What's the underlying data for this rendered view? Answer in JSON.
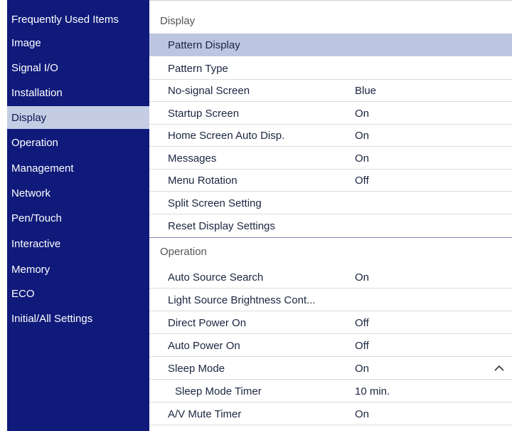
{
  "sidebar": {
    "items": [
      {
        "label": "Frequently Used Items"
      },
      {
        "label": "Image"
      },
      {
        "label": "Signal I/O"
      },
      {
        "label": "Installation"
      },
      {
        "label": "Display"
      },
      {
        "label": "Operation"
      },
      {
        "label": "Management"
      },
      {
        "label": "Network"
      },
      {
        "label": "Pen/Touch"
      },
      {
        "label": "Interactive"
      },
      {
        "label": "Memory"
      },
      {
        "label": "ECO"
      },
      {
        "label": "Initial/All Settings"
      }
    ],
    "active": "Display"
  },
  "main": {
    "display_section": {
      "title": "Display",
      "rows": [
        {
          "label": "Pattern Display",
          "value": ""
        },
        {
          "label": "Pattern Type",
          "value": ""
        },
        {
          "label": "No-signal Screen",
          "value": "Blue"
        },
        {
          "label": "Startup Screen",
          "value": "On"
        },
        {
          "label": "Home Screen Auto Disp.",
          "value": "On"
        },
        {
          "label": "Messages",
          "value": "On"
        },
        {
          "label": "Menu Rotation",
          "value": "Off"
        },
        {
          "label": "Split Screen Setting",
          "value": ""
        },
        {
          "label": "Reset Display Settings",
          "value": ""
        }
      ]
    },
    "operation_section": {
      "title": "Operation",
      "rows": [
        {
          "label": "Auto Source Search",
          "value": "On"
        },
        {
          "label": "Light Source Brightness Cont...",
          "value": ""
        },
        {
          "label": "Direct Power On",
          "value": "Off"
        },
        {
          "label": "Auto Power On",
          "value": "Off"
        },
        {
          "label": "Sleep Mode",
          "value": "On"
        },
        {
          "label": "Sleep Mode Timer",
          "value": "10 min."
        },
        {
          "label": "A/V Mute Timer",
          "value": "On"
        }
      ]
    },
    "icons": {
      "sleep_mode_toggle": "chevron-up-icon"
    }
  }
}
